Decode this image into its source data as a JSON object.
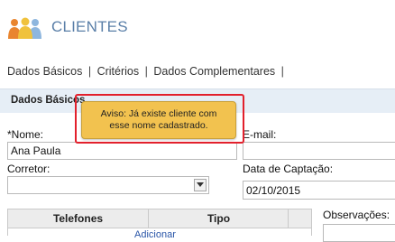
{
  "header": {
    "title": "CLIENTES",
    "icon": "users-group-icon"
  },
  "tabs": [
    {
      "label": "Dados Básicos"
    },
    {
      "label": "Critérios"
    },
    {
      "label": "Dados Complementares"
    }
  ],
  "tab_separator": "|",
  "section": {
    "title": "Dados Básicos"
  },
  "form": {
    "nome": {
      "label": "*Nome:",
      "value": "Ana Paula"
    },
    "email": {
      "label": "E-mail:",
      "value": ""
    },
    "corretor": {
      "label": "Corretor:",
      "value": ""
    },
    "data_captacao": {
      "label": "Data de Captação:",
      "value": "02/10/2015"
    },
    "observacoes": {
      "label": "Observações:"
    }
  },
  "phones_table": {
    "headers": [
      "Telefones",
      "Tipo"
    ],
    "add_label": "Adicionar"
  },
  "tooltip": {
    "line1": "Aviso: Já existe cliente com",
    "line2": "esse nome cadastrado."
  },
  "colors": {
    "title": "#5a7fa8",
    "section_band": "#e6eef6",
    "tooltip_bg": "#f2c24f",
    "highlight_outline": "#e2202c",
    "icon_orange": "#e9852f",
    "icon_yellow": "#f0c23c",
    "icon_blue": "#8eb6de"
  }
}
